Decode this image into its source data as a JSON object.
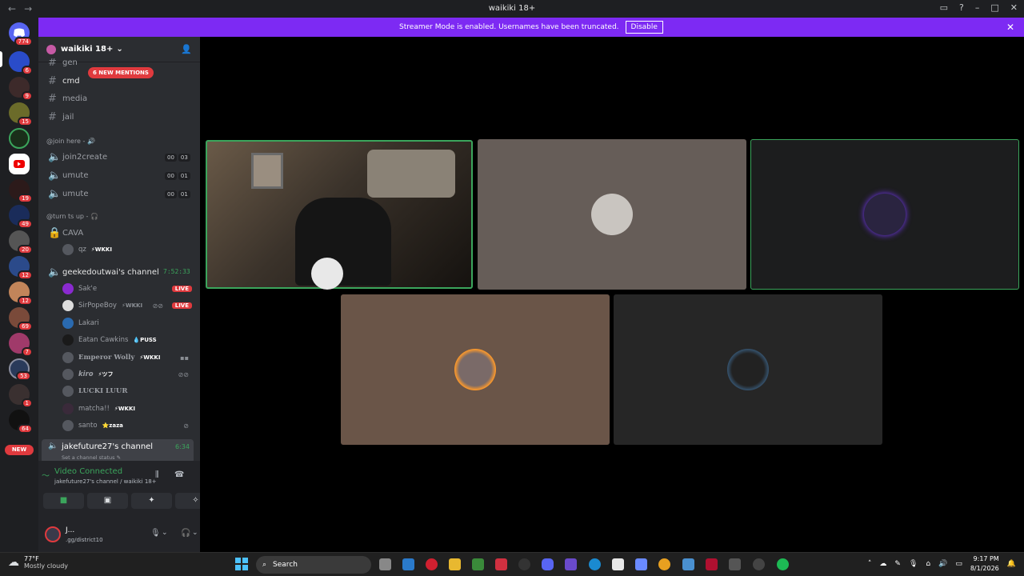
{
  "window": {
    "title": "waikiki 18+",
    "back": "←",
    "forward": "→"
  },
  "banner": {
    "text": "Streamer Mode is enabled. Usernames have been truncated.",
    "button": "Disable"
  },
  "guilds": {
    "home_badge": "774",
    "items": [
      {
        "badge": "6"
      },
      {
        "badge": "9"
      },
      {
        "badge": "15"
      },
      {
        "badge": ""
      },
      {
        "badge": ""
      },
      {
        "badge": "19"
      },
      {
        "badge": "49"
      },
      {
        "badge": "20"
      },
      {
        "badge": "12"
      },
      {
        "badge": "12"
      },
      {
        "badge": "69"
      },
      {
        "badge": "7"
      },
      {
        "badge": "53"
      },
      {
        "badge": "1"
      },
      {
        "badge": "64"
      }
    ],
    "new_label": "NEW"
  },
  "server": {
    "name": "waikiki 18+",
    "mentions": "6 NEW MENTIONS",
    "channels": [
      {
        "name": "gen"
      },
      {
        "name": "cmd"
      },
      {
        "name": "media"
      },
      {
        "name": "jail"
      }
    ],
    "cat_join": "@join here - 🔊",
    "voice1": [
      {
        "name": "join2create",
        "c1": "00",
        "c2": "03"
      },
      {
        "name": "umute",
        "c1": "00",
        "c2": "01"
      },
      {
        "name": "umute",
        "c1": "00",
        "c2": "01"
      }
    ],
    "cat_turn": "@turn ts up - 🎧",
    "cava": {
      "name": "CAVA",
      "user": "qz",
      "tag": "⚡WKKI"
    },
    "gk_channel": {
      "name": "geekedoutwai's channel",
      "timer": "7:52:33"
    },
    "gk_users": [
      {
        "name": "Sak'e",
        "tag": "",
        "live": "LIVE"
      },
      {
        "name": "SirPopeBoy",
        "tag": "⚡WKKI",
        "live": "LIVE"
      },
      {
        "name": "Lakari",
        "tag": "",
        "live": ""
      },
      {
        "name": "Eatan Cawkins",
        "tag": "💧PUSS",
        "live": ""
      },
      {
        "name": "Emperor Wolly",
        "tag": "⚡WKKI",
        "live": ""
      },
      {
        "name": "kiro",
        "tag": "⚡ツフ",
        "live": ""
      },
      {
        "name": "LUCKI LUUR",
        "tag": "",
        "live": ""
      },
      {
        "name": "matcha!!",
        "tag": "⚡WKKI",
        "live": ""
      },
      {
        "name": "santo",
        "tag": "⭐zaza",
        "live": ""
      }
    ],
    "jake_channel": {
      "name": "jakefuture27's channel",
      "timer": "6:34",
      "status": "Set a channel status ✎"
    }
  },
  "voice_panel": {
    "status": "Video Connected",
    "sub": "jakefuture27's channel / waikiki 18+",
    "user_name": "J...",
    "user_status": ".gg/district10"
  },
  "taskbar": {
    "temp": "77°F",
    "weather": "Mostly cloudy",
    "weather_badge": "1",
    "search": "Search",
    "time": "9:17 PM",
    "date": "8/1/2026"
  },
  "colors": {
    "accent": "#7d2af3",
    "live": "#e03a3e",
    "connected": "#3ba55c"
  }
}
